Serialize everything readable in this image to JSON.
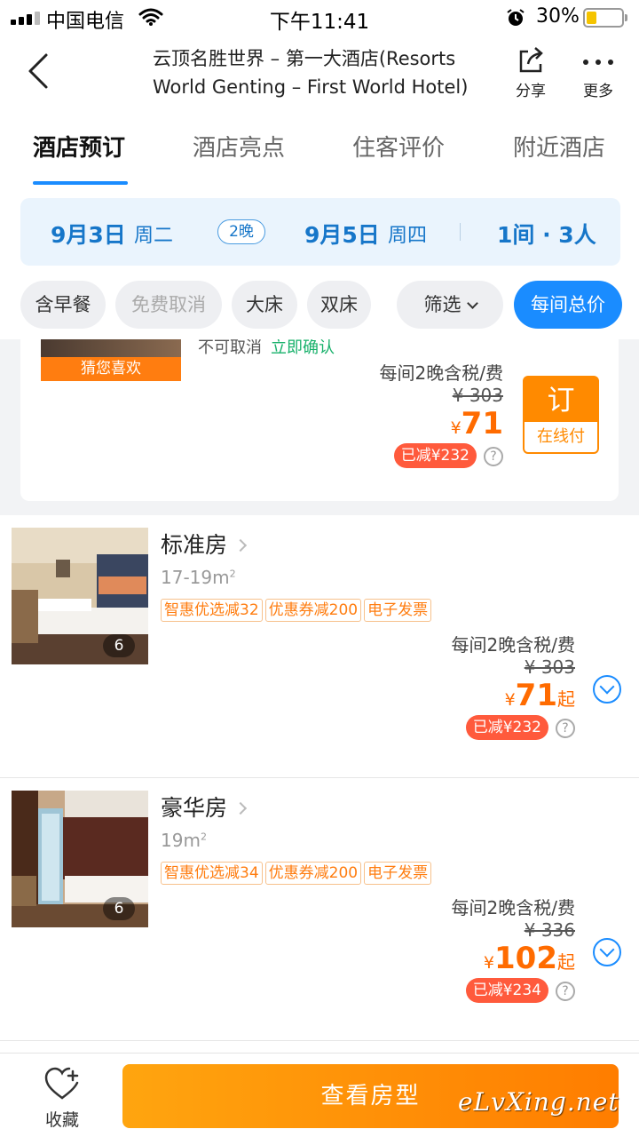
{
  "status_bar": {
    "carrier": "中国电信",
    "time": "下午11:41",
    "battery": "30%",
    "battery_level": 0.3
  },
  "header": {
    "title": "云顶名胜世界 – 第一大酒店(Resorts World Genting – First World Hotel)",
    "share_label": "分享",
    "more_label": "更多"
  },
  "tabs": [
    {
      "label": "酒店预订",
      "active": true
    },
    {
      "label": "酒店亮点",
      "active": false
    },
    {
      "label": "住客评价",
      "active": false
    },
    {
      "label": "附近酒店",
      "active": false
    }
  ],
  "stay": {
    "checkin_date": "9月3日",
    "checkin_weekday": "周二",
    "nights": "2晚",
    "checkout_date": "9月5日",
    "checkout_weekday": "周四",
    "rooms_guests": "1间 · 3人"
  },
  "filters": {
    "chips": [
      "含早餐",
      "免费取消",
      "大床",
      "双床"
    ],
    "filter_label": "筛选",
    "price_mode": "每间总价"
  },
  "featured": {
    "badge": "猜您喜欢",
    "cut_text": "不可取消",
    "cut_text_green": "立即确认",
    "per_night": "每间2晚含税/费",
    "original_price": "¥ 303",
    "currency": "¥",
    "price": "71",
    "discount": "已减¥232",
    "help": "?",
    "book_label": "订",
    "book_sub": "在线付"
  },
  "rooms": [
    {
      "name": "标准房",
      "area": "17-19m",
      "area_unit": "2",
      "photo_count": "6",
      "tags": [
        "智惠优选减32",
        "优惠券减200",
        "电子发票"
      ],
      "per_night": "每间2晚含税/费",
      "original_price": "¥ 303",
      "currency": "¥",
      "price": "71",
      "price_suffix": "起",
      "discount": "已减¥232",
      "help": "?"
    },
    {
      "name": "豪华房",
      "area": "19m",
      "area_unit": "2",
      "photo_count": "6",
      "tags": [
        "智惠优选减34",
        "优惠券减200",
        "电子发票"
      ],
      "per_night": "每间2晚含税/费",
      "original_price": "¥ 336",
      "currency": "¥",
      "price": "102",
      "price_suffix": "起",
      "discount": "已减¥234",
      "help": "?"
    }
  ],
  "bottom": {
    "favorite_label": "收藏",
    "view_rooms_label": "查看房型"
  },
  "watermark": "eLvXing.net",
  "colors": {
    "accent_blue": "#1a8cff",
    "price_orange": "#ff6b00",
    "discount_red": "#ff5a3c",
    "button_orange": "#ff8a00"
  }
}
